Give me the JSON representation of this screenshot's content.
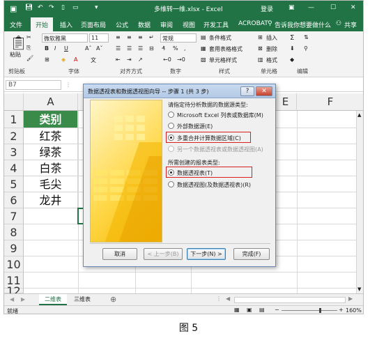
{
  "window": {
    "title": "多维转一维.xlsx - Excel",
    "login": "登录"
  },
  "tabs": [
    "文件",
    "开始",
    "插入",
    "页面布局",
    "公式",
    "数据",
    "审阅",
    "视图",
    "开发工具",
    "ACROBAT"
  ],
  "tell_me": "告诉我你想要做什么",
  "share": "共享",
  "ribbon": {
    "paste": "粘贴",
    "font_name": "微软雅黑",
    "font_size": "11",
    "number_format": "常规",
    "conditional": "条件格式",
    "table_format": "套用表格格式",
    "cell_style": "单元格样式",
    "insert": "插入",
    "delete": "删除",
    "format": "格式",
    "groups": {
      "clipboard": "剪贴板",
      "font": "字体",
      "alignment": "对齐方式",
      "number": "数字",
      "styles": "样式",
      "cells": "单元格",
      "editing": "编辑"
    }
  },
  "namebox": "B7",
  "columns": [
    "A",
    "E",
    "F"
  ],
  "rows": [
    "1",
    "2",
    "3",
    "4",
    "5",
    "6",
    "7",
    "8",
    "9",
    "10",
    "11",
    "12"
  ],
  "cells_A": [
    "类别",
    "红茶",
    "绿茶",
    "白茶",
    "毛尖",
    "龙井"
  ],
  "sheets": [
    "二维表",
    "三维表"
  ],
  "status": {
    "ready": "就绪",
    "zoom": "160%"
  },
  "dialog": {
    "title": "数据透视表和数据透视图向导 -- 步骤 1 (共 3 步)",
    "section1": "请指定待分析数据的数据源类型:",
    "opt1": "Microsoft Excel 列表或数据库(M)",
    "opt2": "外部数据源(E)",
    "opt3": "多重合并计算数据区域(C)",
    "opt4": "另一个数据透视表或数据透视图(A)",
    "section2": "所需创建的报表类型:",
    "opt5": "数据透视表(T)",
    "opt6": "数据透视图(及数据透视表)(R)",
    "cancel": "取消",
    "back": "< 上一步(B)",
    "next": "下一步(N) >",
    "finish": "完成(F)"
  },
  "caption": "图 5",
  "colors": {
    "excel_green": "#217346",
    "header_fill": "#3a8a4a",
    "highlight": "#d81e1e"
  }
}
